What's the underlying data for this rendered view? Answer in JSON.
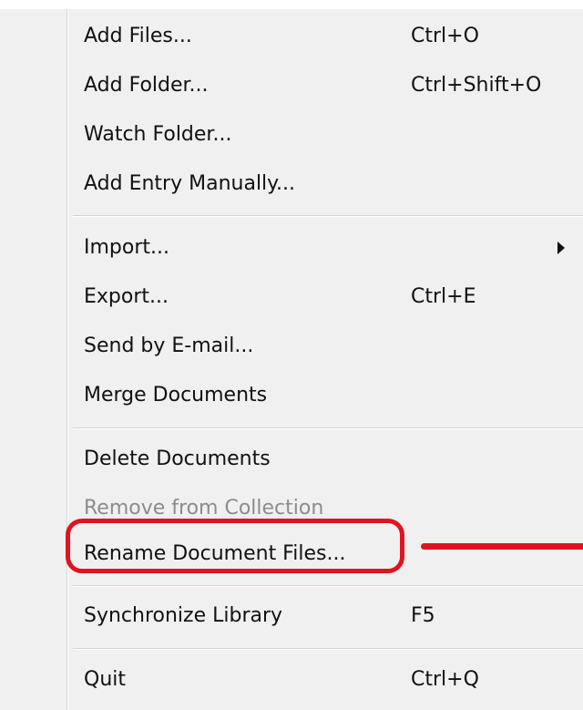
{
  "menu": {
    "groups": [
      {
        "items": [
          {
            "label": "Add Files...",
            "shortcut": "Ctrl+O"
          },
          {
            "label": "Add Folder...",
            "shortcut": "Ctrl+Shift+O"
          },
          {
            "label": "Watch Folder...",
            "shortcut": ""
          },
          {
            "label": "Add Entry Manually...",
            "shortcut": ""
          }
        ]
      },
      {
        "items": [
          {
            "label": "Import...",
            "shortcut": "",
            "submenu_icon": "triangle-right-icon"
          },
          {
            "label": "Export...",
            "shortcut": "Ctrl+E"
          },
          {
            "label": "Send by E-mail...",
            "shortcut": ""
          },
          {
            "label": "Merge Documents",
            "shortcut": ""
          }
        ]
      },
      {
        "items": [
          {
            "label": "Delete Documents",
            "shortcut": ""
          },
          {
            "label": "Remove from Collection",
            "shortcut": "",
            "disabled": true
          },
          {
            "label": "Rename Document Files...",
            "shortcut": "",
            "highlighted": true
          }
        ]
      },
      {
        "items": [
          {
            "label": "Synchronize Library",
            "shortcut": "F5"
          }
        ]
      },
      {
        "items": [
          {
            "label": "Quit",
            "shortcut": "Ctrl+Q"
          }
        ]
      }
    ]
  },
  "annotation": {
    "color": "#e0141e",
    "shape": "rounded-rectangle-with-pointer-line"
  },
  "colors": {
    "menu_background": "#f0f0f0",
    "text": "#111111",
    "disabled_text": "#8c8c8c"
  }
}
